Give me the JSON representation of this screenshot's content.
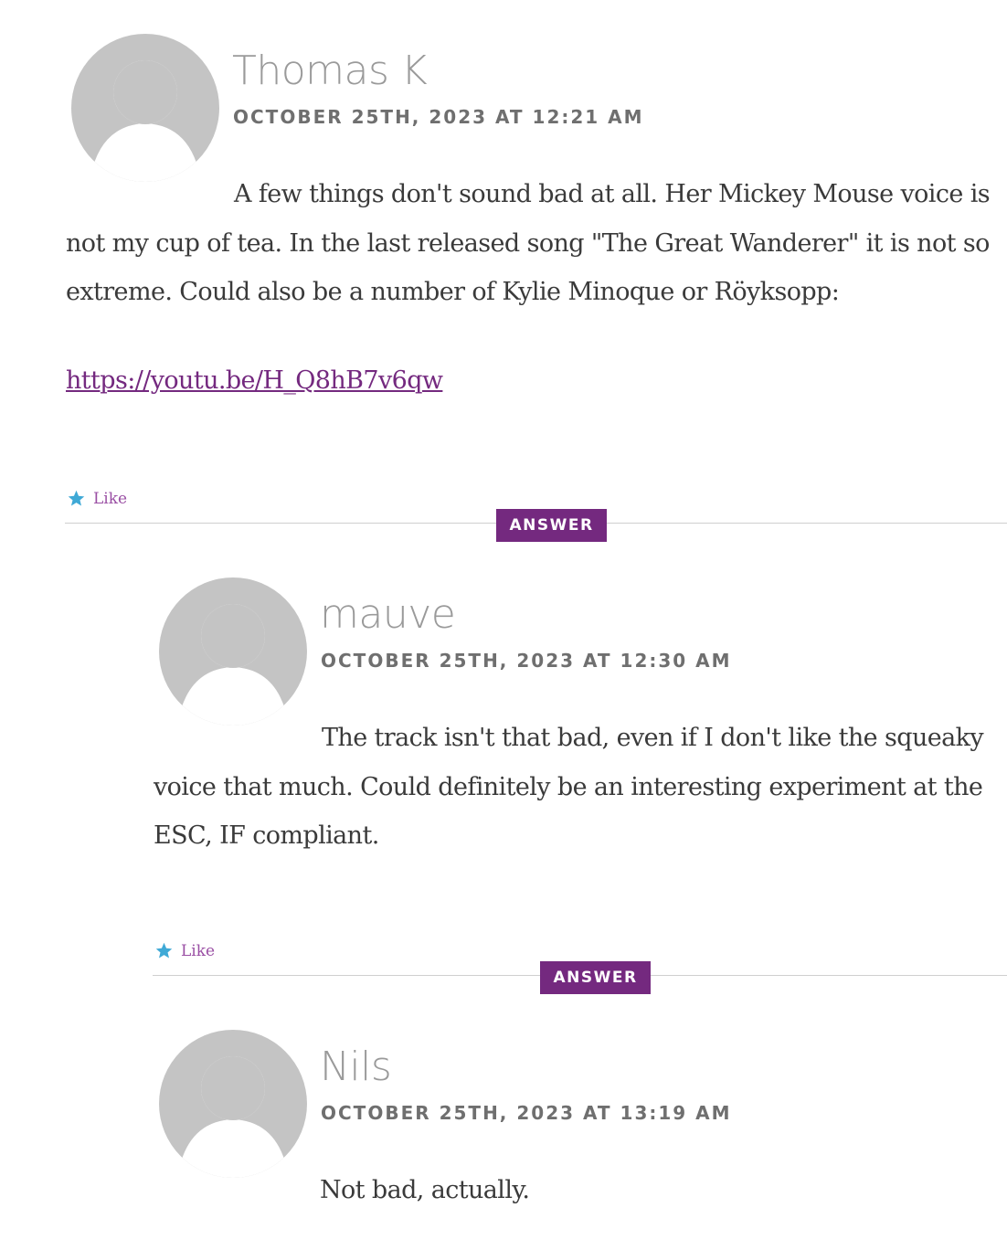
{
  "comments": [
    {
      "author": "Thomas K",
      "date": "OCTOBER 25TH, 2023 AT 12:21 AM",
      "text": "A few things don't sound bad at all. Her Mickey Mouse voice is not my cup of tea. In the last released song \"The Great Wanderer\" it is not so extreme. Could also be a number of Kylie Minoque or Röyksopp:",
      "link": "https://youtu.be/H_Q8hB7v6qw",
      "like_label": "Like",
      "answer_label": "ANSWER"
    },
    {
      "author": "mauve",
      "date": "OCTOBER 25TH, 2023 AT 12:30 AM",
      "text": "The track isn't that bad, even if I don't like the squeaky voice that much. Could definitely be an interesting experiment at the ESC, IF compliant.",
      "like_label": "Like",
      "answer_label": "ANSWER"
    },
    {
      "author": "Nils",
      "date": "OCTOBER 25TH, 2023 AT 13:19 AM",
      "text": "Not bad, actually."
    }
  ],
  "colors": {
    "accent": "#74297f",
    "star": "#3fa9d6",
    "avatar": "#c4c4c4"
  },
  "icons": {
    "avatar": "default-avatar-icon",
    "like": "star-icon"
  }
}
